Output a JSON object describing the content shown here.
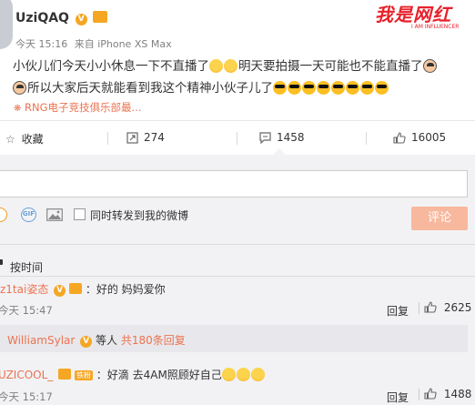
{
  "post": {
    "author": "UziQAQ",
    "time": "今天 15:16",
    "via": "来自 iPhone XS Max",
    "text_line1": "小伙儿们今天小小休息一下不直播了",
    "text_line1b": "明天要拍摄一天可能也不能直播了",
    "text_line2": "所以大家后天就能看到我这个精神小伙子儿了",
    "source_link": "RNG电子竞技俱乐部最..."
  },
  "watermark": {
    "text": "我是网红",
    "sub": "I AM INFLUENCER"
  },
  "actions": {
    "favorite_label": "收藏",
    "repost_count": "274",
    "comment_count": "1458",
    "like_count": "16005"
  },
  "composer": {
    "input_value": "",
    "repost_checkbox_label": "同时转发到我的微博",
    "submit_label": "评论"
  },
  "sort": {
    "label": "按时间"
  },
  "comments": [
    {
      "user": "z1tai姿态",
      "text": "：好的 妈妈爱你",
      "time": "今天 15:47",
      "reply_label": "回复",
      "likes": "2625"
    },
    {
      "user": "UZICOOL_",
      "badge": "铁粉",
      "text": "：好滴 去4AM照顾好自己",
      "time": "今天 15:17",
      "reply_label": "回复",
      "likes": "1488"
    }
  ],
  "reply_summary": {
    "user": "WilliamSylar",
    "text": "等人",
    "count_text": "共180条回复"
  },
  "colors": {
    "accent": "#eb7350",
    "submit_bg": "#f7b89e",
    "verified": "#f5a623"
  }
}
